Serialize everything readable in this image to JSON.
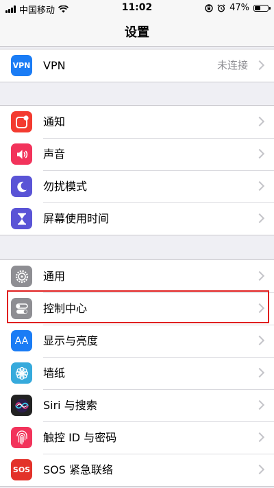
{
  "status_bar": {
    "carrier": "中国移动",
    "time": "11:02",
    "battery_percent": "47%",
    "battery_level": 0.47
  },
  "nav": {
    "title": "设置"
  },
  "vpn_group": {
    "items": [
      {
        "label": "VPN",
        "icon_text": "VPN",
        "value": "未连接",
        "icon": "vpn-icon",
        "color": "#1a7cf5"
      }
    ]
  },
  "notify_group": {
    "items": [
      {
        "label": "通知",
        "icon": "notifications-icon",
        "color": "#f33b30"
      },
      {
        "label": "声音",
        "icon": "sounds-icon",
        "color": "#f2335b"
      },
      {
        "label": "勿扰模式",
        "icon": "moon-icon",
        "color": "#5a54d6"
      },
      {
        "label": "屏幕使用时间",
        "icon": "hourglass-icon",
        "color": "#5a54d6"
      }
    ]
  },
  "general_group": {
    "items": [
      {
        "label": "通用",
        "icon": "gear-icon",
        "color": "#8e8e93"
      },
      {
        "label": "控制中心",
        "icon": "toggles-icon",
        "color": "#8e8e93"
      },
      {
        "label": "显示与亮度",
        "icon_text": "AA",
        "icon": "display-icon",
        "color": "#1a7cf5"
      },
      {
        "label": "墙纸",
        "icon": "flower-icon",
        "color": "#36aadc"
      },
      {
        "label": "Siri 与搜索",
        "icon": "siri-icon",
        "color": "#222222"
      },
      {
        "label": "触控 ID 与密码",
        "icon": "fingerprint-icon",
        "color": "#f2335b"
      },
      {
        "label": "SOS 紧急联络",
        "icon_text": "SOS",
        "icon": "sos-icon",
        "color": "#e3322a"
      }
    ]
  },
  "colors": {
    "background": "#efeff4",
    "highlight": "#e02020",
    "chevron": "#c4c4c9"
  }
}
